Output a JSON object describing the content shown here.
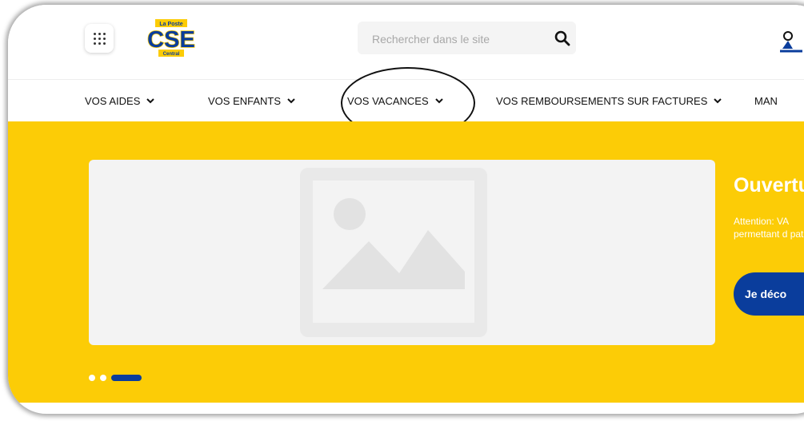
{
  "header": {
    "apps_icon": "grid-dots-icon",
    "logo": {
      "top_text": "La Poste",
      "main_text": "CSE",
      "bottom_text": "Central",
      "colors": {
        "blue": "#0a3d9c",
        "yellow": "#fccc06"
      }
    },
    "search": {
      "placeholder": "Rechercher dans le site",
      "value": "",
      "icon": "search-icon"
    },
    "user_icon": "user-icon"
  },
  "nav": {
    "items": [
      {
        "label": "VOS AIDES",
        "icon": "chevron-down-icon"
      },
      {
        "label": "VOS ENFANTS",
        "icon": "chevron-down-icon"
      },
      {
        "label": "VOS VACANCES",
        "icon": "chevron-down-icon",
        "highlighted": true
      },
      {
        "label": "VOS REMBOURSEMENTS SUR FACTURES",
        "icon": "chevron-down-icon"
      },
      {
        "label": "MAN",
        "icon": ""
      }
    ]
  },
  "hero": {
    "background": "#fccc06",
    "image_icon": "image-placeholder-icon",
    "promo": {
      "title": "Ouvertu",
      "text": "Attention: VA permettant d patient...",
      "button_label": "Je déco"
    },
    "pager": {
      "count": 3,
      "active_index": 2
    }
  },
  "colors": {
    "accent": "#0a3d9c",
    "banner": "#fccc06"
  }
}
